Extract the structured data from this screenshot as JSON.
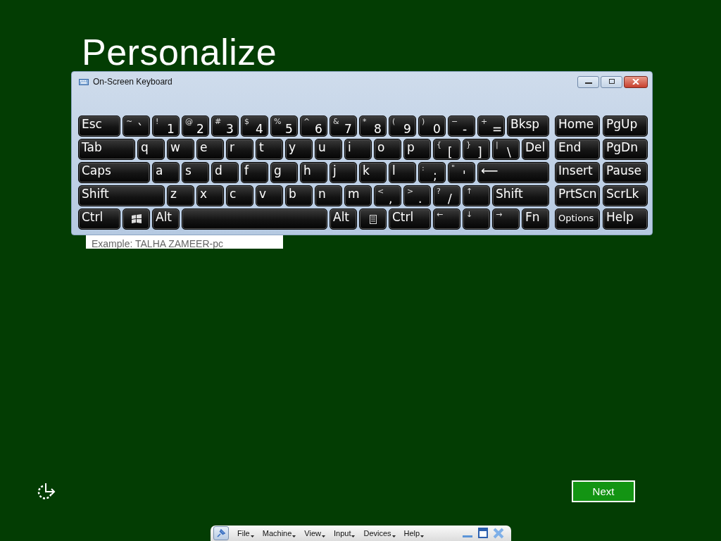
{
  "page": {
    "title": "Personalize",
    "name_field": {
      "placeholder": "Example: TALHA ZAMEER-pc"
    },
    "next_button": "Next"
  },
  "keyboard_window": {
    "title": "On-Screen Keyboard",
    "rows": [
      {
        "keys": [
          {
            "kind": "key",
            "label": "Esc"
          },
          {
            "kind": "key",
            "top": "~",
            "label": "`"
          },
          {
            "kind": "key",
            "top": "!",
            "label": "1"
          },
          {
            "kind": "key",
            "top": "@",
            "label": "2"
          },
          {
            "kind": "key",
            "top": "#",
            "label": "3"
          },
          {
            "kind": "key",
            "top": "$",
            "label": "4"
          },
          {
            "kind": "key",
            "top": "%",
            "label": "5"
          },
          {
            "kind": "key",
            "top": "^",
            "label": "6"
          },
          {
            "kind": "key",
            "top": "&",
            "label": "7"
          },
          {
            "kind": "key",
            "top": "*",
            "label": "8"
          },
          {
            "kind": "key",
            "top": "(",
            "label": "9"
          },
          {
            "kind": "key",
            "top": ")",
            "label": "0"
          },
          {
            "kind": "key",
            "top": "−",
            "label": "-"
          },
          {
            "kind": "key",
            "top": "+",
            "label": "="
          },
          {
            "kind": "key",
            "label": "Bksp"
          }
        ]
      },
      {
        "keys": [
          {
            "kind": "key",
            "label": "Tab"
          },
          {
            "kind": "key",
            "label": "q"
          },
          {
            "kind": "key",
            "label": "w"
          },
          {
            "kind": "key",
            "label": "e"
          },
          {
            "kind": "key",
            "label": "r"
          },
          {
            "kind": "key",
            "label": "t"
          },
          {
            "kind": "key",
            "label": "y"
          },
          {
            "kind": "key",
            "label": "u"
          },
          {
            "kind": "key",
            "label": "i"
          },
          {
            "kind": "key",
            "label": "o"
          },
          {
            "kind": "key",
            "label": "p"
          },
          {
            "kind": "key",
            "top": "{",
            "label": "["
          },
          {
            "kind": "key",
            "top": "}",
            "label": "]"
          },
          {
            "kind": "key",
            "top": "|",
            "label": "\\"
          },
          {
            "kind": "key",
            "label": "Del"
          }
        ]
      },
      {
        "keys": [
          {
            "kind": "key",
            "label": "Caps"
          },
          {
            "kind": "key",
            "label": "a"
          },
          {
            "kind": "key",
            "label": "s"
          },
          {
            "kind": "key",
            "label": "d"
          },
          {
            "kind": "key",
            "label": "f"
          },
          {
            "kind": "key",
            "label": "g"
          },
          {
            "kind": "key",
            "label": "h"
          },
          {
            "kind": "key",
            "label": "j"
          },
          {
            "kind": "key",
            "label": "k"
          },
          {
            "kind": "key",
            "label": "l"
          },
          {
            "kind": "key",
            "top": ":",
            "label": ";"
          },
          {
            "kind": "key",
            "top": "\"",
            "label": "'"
          },
          {
            "kind": "key",
            "label": "⟵"
          }
        ]
      },
      {
        "keys": [
          {
            "kind": "key",
            "label": "Shift"
          },
          {
            "kind": "key",
            "label": "z"
          },
          {
            "kind": "key",
            "label": "x"
          },
          {
            "kind": "key",
            "label": "c"
          },
          {
            "kind": "key",
            "label": "v"
          },
          {
            "kind": "key",
            "label": "b"
          },
          {
            "kind": "key",
            "label": "n"
          },
          {
            "kind": "key",
            "label": "m"
          },
          {
            "kind": "key",
            "top": "<",
            "label": ","
          },
          {
            "kind": "key",
            "top": ">",
            "label": "."
          },
          {
            "kind": "key",
            "top": "?",
            "label": "/"
          },
          {
            "kind": "key",
            "top": "↑"
          },
          {
            "kind": "key",
            "label": "Shift"
          }
        ]
      },
      {
        "keys": [
          {
            "kind": "key",
            "label": "Ctrl"
          },
          {
            "kind": "windows"
          },
          {
            "kind": "key",
            "label": "Alt"
          },
          {
            "kind": "space"
          },
          {
            "kind": "key",
            "label": "Alt"
          },
          {
            "kind": "menu"
          },
          {
            "kind": "key",
            "label": "Ctrl"
          },
          {
            "kind": "key",
            "top": "←"
          },
          {
            "kind": "key",
            "top": "↓"
          },
          {
            "kind": "key",
            "top": "→"
          },
          {
            "kind": "key",
            "label": "Fn"
          }
        ]
      }
    ],
    "nav_keys": [
      "Home",
      "PgUp",
      "End",
      "PgDn",
      "Insert",
      "Pause",
      "PrtScn",
      "ScrLk",
      "Options",
      "Help"
    ]
  },
  "vm_toolbar": {
    "menus": [
      "File",
      "Machine",
      "View",
      "Input",
      "Devices",
      "Help"
    ]
  }
}
